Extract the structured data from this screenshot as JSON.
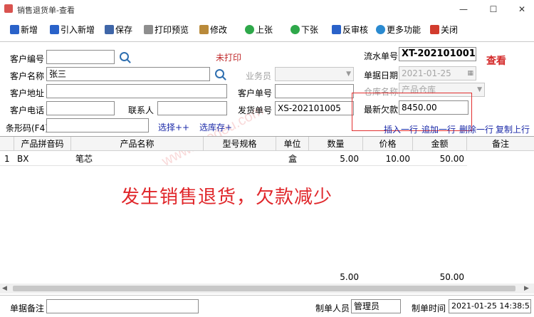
{
  "window": {
    "title": "销售退货单-查看",
    "minimize": "—",
    "maximize": "☐",
    "close": "✕"
  },
  "toolbar": {
    "new": "新增",
    "import_new": "引入新增",
    "save": "保存",
    "print_preview": "打印预览",
    "modify": "修改",
    "prev": "上张",
    "next": "下张",
    "unapprove": "反审核",
    "more": "更多功能",
    "close": "关闭"
  },
  "form": {
    "customer_code_label": "客户编号",
    "customer_code": "",
    "print_status": "未打印",
    "serial_no_label": "流水单号",
    "serial_no": "XT-202101001",
    "mode": "查看",
    "customer_name_label": "客户名称",
    "customer_name": "张三",
    "salesperson_label": "业务员",
    "salesperson": "",
    "doc_date_label": "单据日期",
    "doc_date": "2021-01-25",
    "customer_address_label": "客户地址",
    "customer_address": "",
    "customer_order_label": "客户单号",
    "customer_order": "",
    "warehouse_label": "仓库名称",
    "warehouse": "产品仓库",
    "customer_phone_label": "客户电话",
    "customer_phone": "",
    "contact_label": "联系人",
    "contact": "",
    "delivery_no_label": "发货单号",
    "delivery_no": "XS-202101005",
    "latest_debt_label": "最新欠款",
    "latest_debt": "8450.00",
    "barcode_label": "条形码(F4)",
    "barcode": ""
  },
  "links": {
    "select": "选择++",
    "select_stock": "选库存+",
    "insert_row": "插入一行",
    "append_row": "追加一行",
    "delete_row": "删除一行",
    "copy_row": "复制上行"
  },
  "grid": {
    "headers": [
      "产品拼音码",
      "产品名称",
      "型号规格",
      "单位",
      "数量",
      "价格",
      "金额",
      "备注"
    ],
    "rows": [
      {
        "no": "1",
        "pinyin": "BX",
        "name": "笔芯",
        "spec": "",
        "unit": "盒",
        "qty": "5.00",
        "price": "10.00",
        "amount": "50.00",
        "remark": ""
      }
    ],
    "totals": {
      "qty": "5.00",
      "amount": "50.00"
    }
  },
  "annotation": "发生销售退货，欠款减少",
  "watermark": "www.haodeu.com",
  "footer": {
    "remark_label": "单据备注",
    "remark": "",
    "maker_label": "制单人员",
    "maker": "管理员",
    "time_label": "制单时间",
    "time": "2021-01-25 14:38:55"
  },
  "colors": {
    "accent_red": "#e0262a",
    "link_blue": "#1b2aa8"
  }
}
